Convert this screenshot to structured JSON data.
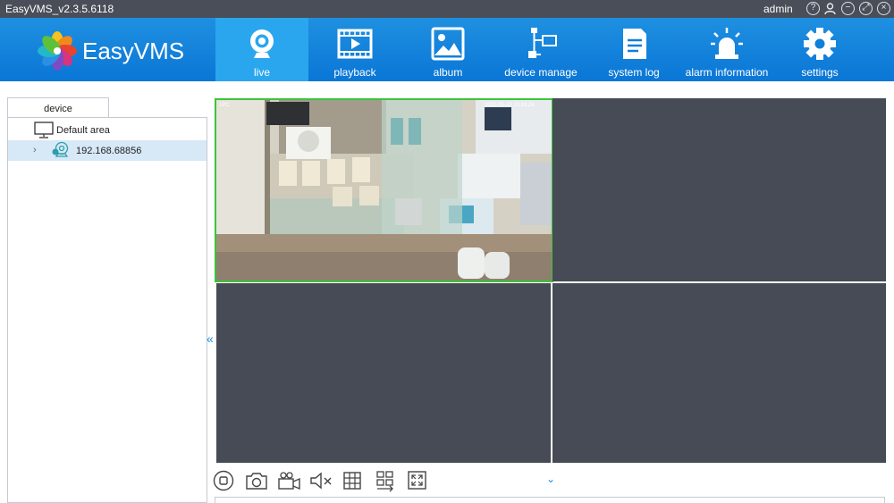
{
  "window": {
    "title": "EasyVMS_v2.3.5.6118",
    "user": "admin",
    "controls": [
      "help-icon",
      "user-icon",
      "minimize-icon",
      "maximize-icon",
      "close-icon"
    ]
  },
  "brand": {
    "name": "EasyVMS"
  },
  "nav": {
    "items": [
      {
        "label": "live",
        "icon": "webcam-icon",
        "active": true
      },
      {
        "label": "playback",
        "icon": "playback-icon"
      },
      {
        "label": "album",
        "icon": "album-icon"
      },
      {
        "label": "device manage",
        "icon": "device-manage-icon"
      },
      {
        "label": "system log",
        "icon": "system-log-icon"
      },
      {
        "label": "alarm information",
        "icon": "alarm-icon"
      },
      {
        "label": "settings",
        "icon": "gear-icon"
      }
    ]
  },
  "device_panel": {
    "tab": "device",
    "tree": [
      {
        "label": "Default area",
        "icon": "monitor-icon"
      },
      {
        "label": "192.168.68856",
        "icon": "camera-icon",
        "selected": true
      }
    ]
  },
  "video_overlay": {
    "top_left": "1PC",
    "top_right": "2020-05-20 10:19:24"
  },
  "toolbar": {
    "tools": [
      "stop-icon",
      "snapshot-icon",
      "record-icon",
      "mute-icon",
      "grid-layout-icon",
      "layout-switch-icon",
      "fullscreen-icon"
    ]
  },
  "colors": {
    "titlebar": "#4a4e58",
    "header": "#0f7fd9",
    "nav_active": "#2aa6ef",
    "empty_cell": "#474b55",
    "active_border": "#3bc43b",
    "selection": "#d7e8f7"
  }
}
